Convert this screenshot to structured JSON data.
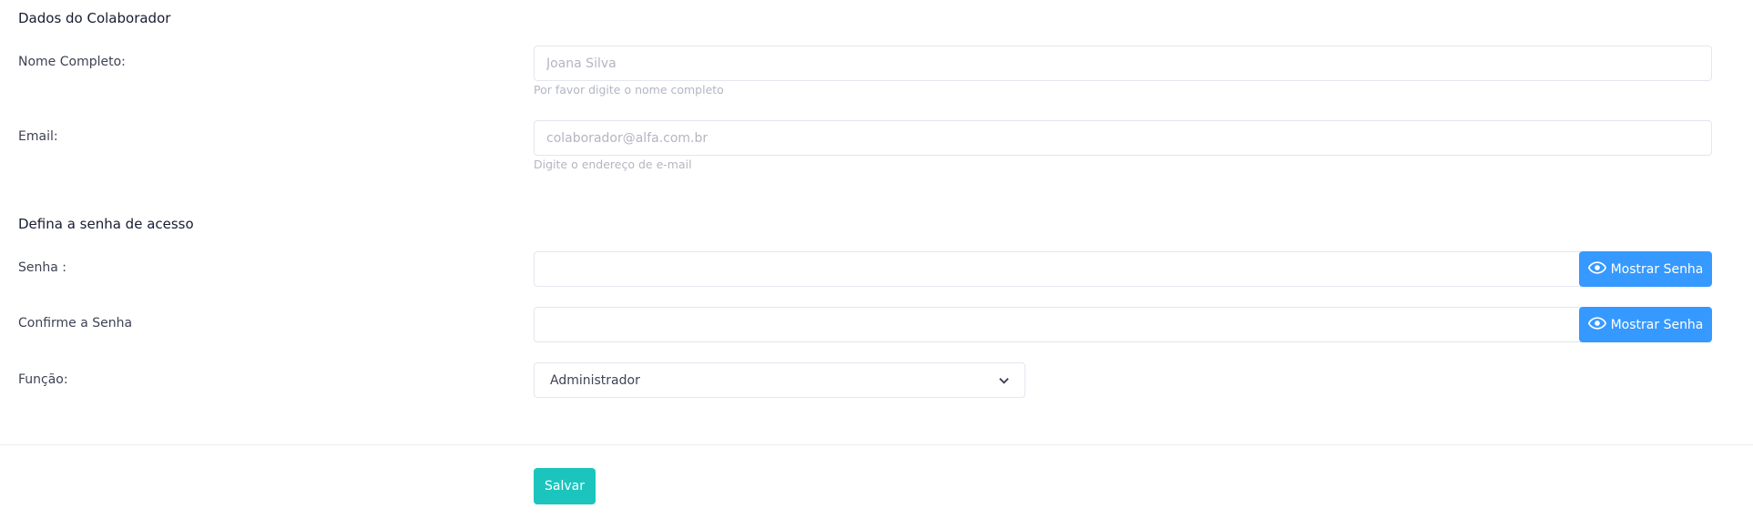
{
  "section_colaborador": {
    "title": "Dados do Colaborador",
    "nome": {
      "label": "Nome Completo:",
      "placeholder": "Joana Silva",
      "help": "Por favor digite o nome completo"
    },
    "email": {
      "label": "Email:",
      "placeholder": "colaborador@alfa.com.br",
      "help": "Digite o endereço de e-mail"
    }
  },
  "section_senha": {
    "title": "Defina a senha de acesso",
    "senha": {
      "label": "Senha :",
      "value": "",
      "button_label": "Mostrar Senha",
      "button_icon": "eye-icon"
    },
    "confirma": {
      "label": "Confirme a Senha",
      "value": "",
      "button_label": "Mostrar Senha",
      "button_icon": "eye-icon"
    },
    "funcao": {
      "label": "Função:",
      "selected": "Administrador",
      "icon": "chevron-down-icon"
    }
  },
  "actions": {
    "save_label": "Salvar"
  },
  "colors": {
    "primary": "#3699ff",
    "success": "#1bc5bd",
    "border": "#e4e6ef",
    "muted_text": "#b5b5c3"
  }
}
